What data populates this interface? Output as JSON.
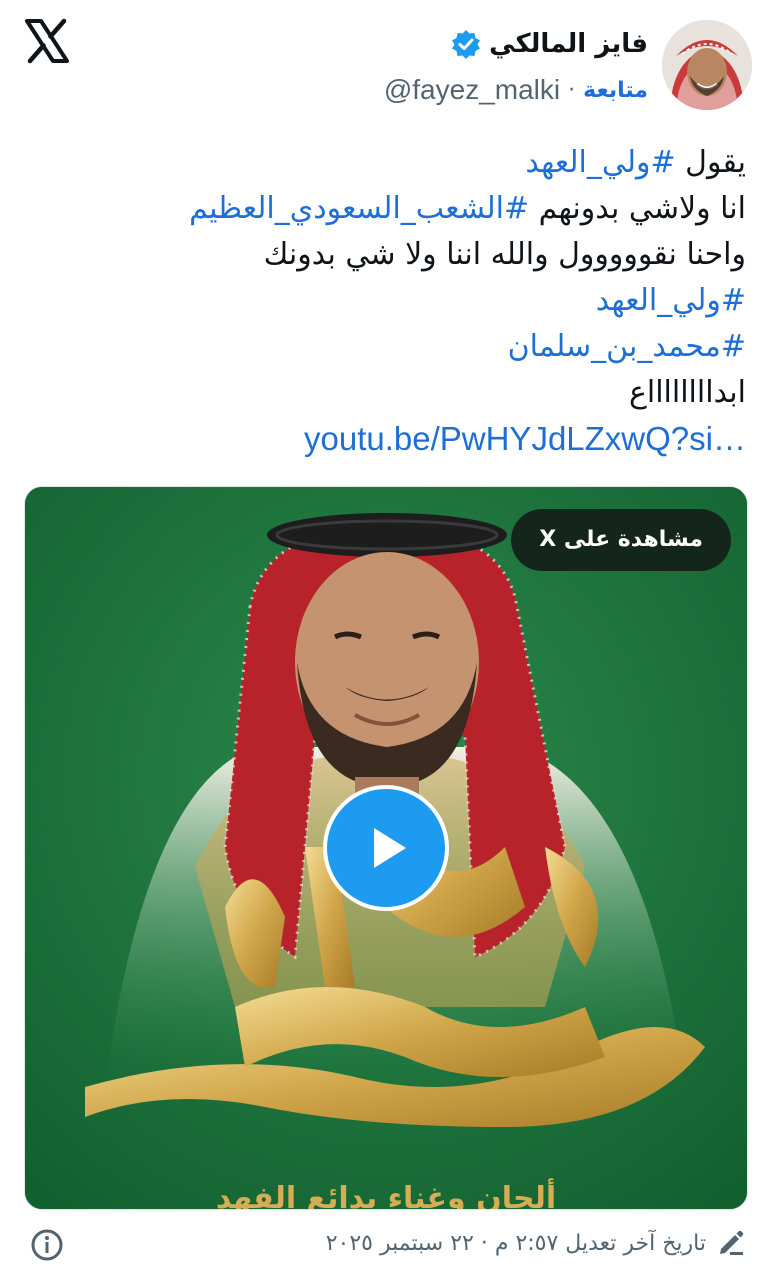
{
  "app": {
    "logo_icon": "x-logo-icon"
  },
  "author": {
    "name": "فايز المالكي",
    "handle": "@fayez_malki",
    "separator": "·",
    "follow_label": "متابعة",
    "verified_color": "#1d9bf0"
  },
  "tweet": {
    "line1": {
      "text": "يقول ",
      "tag": "#ولي_العهد"
    },
    "line2": {
      "text": "انا ولاشي بدونهم ",
      "tag": "#الشعب_السعودي_العظيم"
    },
    "line3": "واحنا نقووووول والله اننا ولا شي بدونك",
    "line4": "#ولي_العهد",
    "line5": "#محمد_بن_سلمان",
    "line6": "ابدااااااااع",
    "link": "youtu.be/PwHYJdLZxwQ?si…",
    "hashtag_color": "#1d6fd6"
  },
  "media": {
    "watch_label": "مشاهدة على X",
    "play_icon": "play-icon",
    "calligraphy_text": "اعتزا محمد",
    "bottom_text": "ألحان وغناء بدائع الفهد",
    "background_color": "#1c7a3f"
  },
  "footer": {
    "edit_label": "تاريخ آخر تعديل ٢:٥٧ م · ٢٢ سبتمبر ٢٠٢٥",
    "edit_icon": "pencil-icon",
    "info_icon": "info-icon"
  }
}
